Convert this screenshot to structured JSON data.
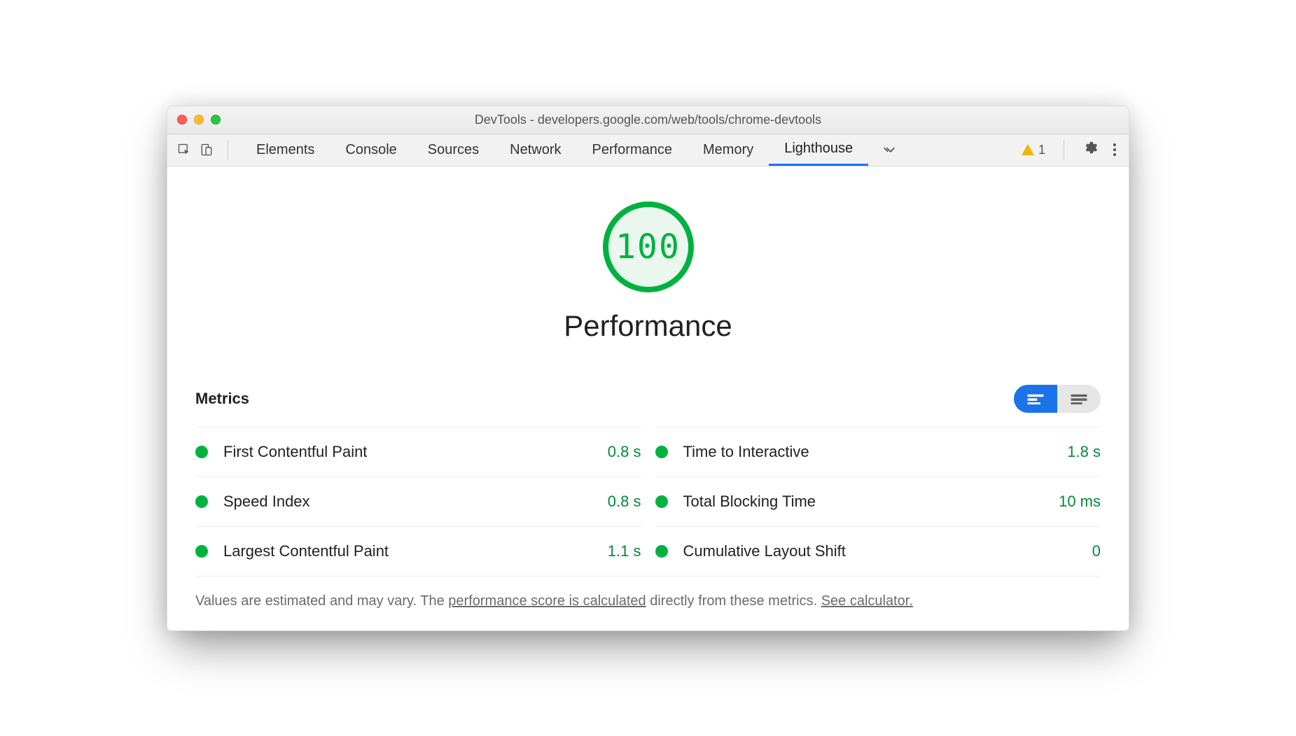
{
  "window": {
    "title": "DevTools - developers.google.com/web/tools/chrome-devtools"
  },
  "tabs": {
    "items": [
      "Elements",
      "Console",
      "Sources",
      "Network",
      "Performance",
      "Memory",
      "Lighthouse"
    ],
    "active_index": 6,
    "warning_count": "1"
  },
  "report": {
    "score": "100",
    "category": "Performance",
    "metrics_heading": "Metrics",
    "metrics_left": [
      {
        "name": "First Contentful Paint",
        "value": "0.8 s"
      },
      {
        "name": "Speed Index",
        "value": "0.8 s"
      },
      {
        "name": "Largest Contentful Paint",
        "value": "1.1 s"
      }
    ],
    "metrics_right": [
      {
        "name": "Time to Interactive",
        "value": "1.8 s"
      },
      {
        "name": "Total Blocking Time",
        "value": "10 ms"
      },
      {
        "name": "Cumulative Layout Shift",
        "value": "0"
      }
    ],
    "footer": {
      "pre": "Values are estimated and may vary. The ",
      "link1": "performance score is calculated",
      "mid": " directly from these metrics. ",
      "link2": "See calculator."
    }
  },
  "colors": {
    "good": "#00b140",
    "tab_active": "#1a73e8"
  }
}
